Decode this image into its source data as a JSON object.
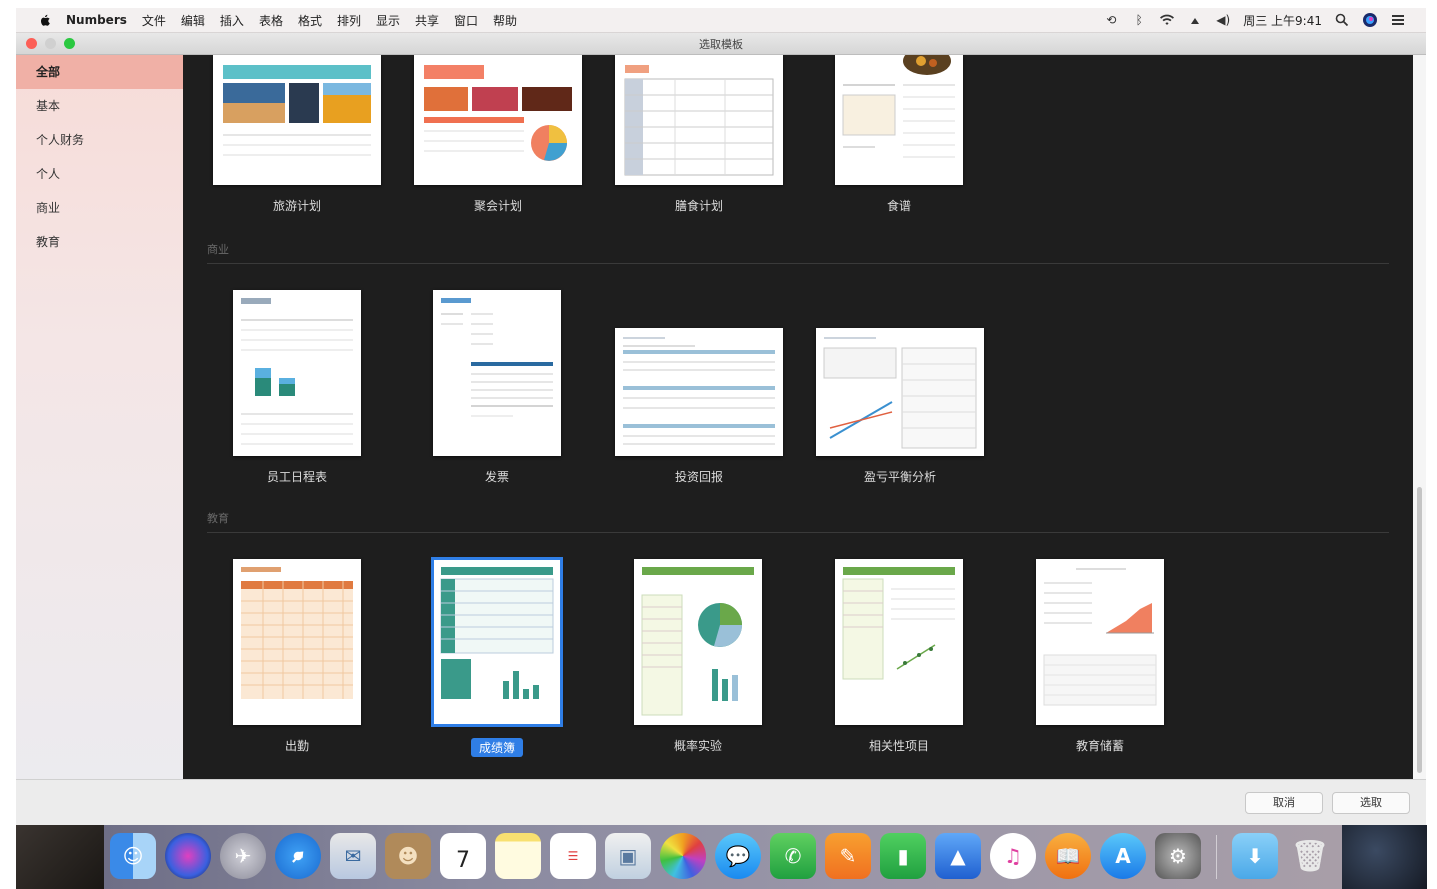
{
  "menubar": {
    "app_name": "Numbers",
    "menus": [
      "文件",
      "编辑",
      "插入",
      "表格",
      "格式",
      "排列",
      "显示",
      "共享",
      "窗口",
      "帮助"
    ],
    "clock": "周三 上午9:41"
  },
  "window": {
    "title": "选取模板"
  },
  "sidebar": {
    "items": [
      {
        "label": "全部",
        "selected": true
      },
      {
        "label": "基本"
      },
      {
        "label": "个人财务"
      },
      {
        "label": "个人"
      },
      {
        "label": "商业"
      },
      {
        "label": "教育"
      }
    ]
  },
  "sections": [
    {
      "name": "",
      "templates": [
        "旅游计划",
        "聚会计划",
        "膳食计划",
        "食谱"
      ]
    },
    {
      "name": "商业",
      "templates": [
        "员工日程表",
        "发票",
        "投资回报",
        "盈亏平衡分析"
      ]
    },
    {
      "name": "教育",
      "templates": [
        "出勤",
        "成绩簿",
        "概率实验",
        "相关性项目",
        "教育储蓄"
      ]
    }
  ],
  "selected_template": "成绩簿",
  "buttons": {
    "cancel": "取消",
    "choose": "选取"
  },
  "dock_calendar_day": "7",
  "colors": {
    "selection": "#2f7ee6",
    "sidebar_selected": "#f0b0a6",
    "content_bg": "#1e1e1e"
  }
}
